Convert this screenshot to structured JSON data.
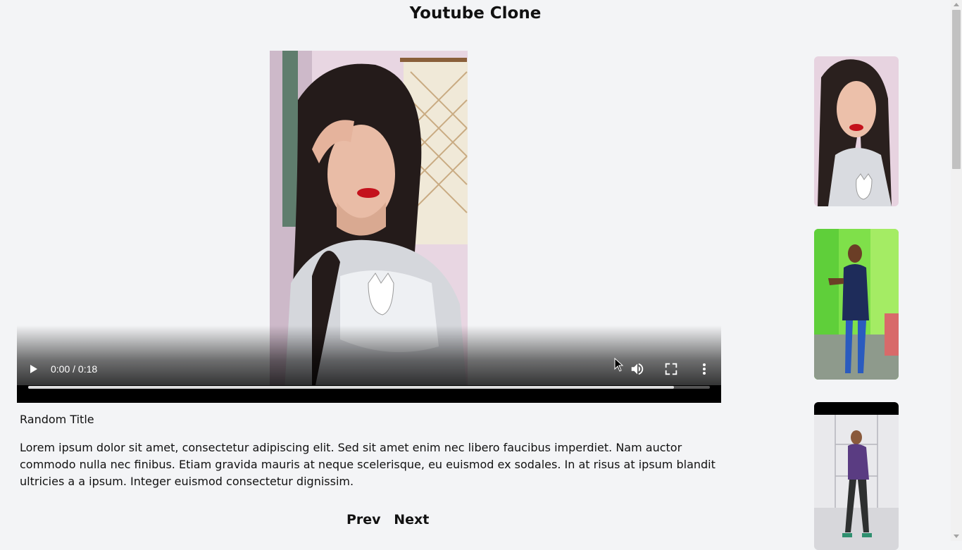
{
  "header": {
    "title": "Youtube Clone"
  },
  "player": {
    "time_display": "0:00 / 0:18",
    "progress_fraction": 0.0,
    "buffered_fraction": 0.947,
    "play_icon": "play-icon",
    "volume_icon": "volume-icon",
    "fullscreen_icon": "fullscreen-icon",
    "menu_icon": "more-vert-icon"
  },
  "video": {
    "title": "Random Title",
    "description": "Lorem ipsum dolor sit amet, consectetur adipiscing elit. Sed sit amet enim nec libero faucibus imperdiet. Nam auctor commodo nulla nec finibus. Etiam gravida mauris at neque scelerisque, eu euismod ex sodales. In at risus at ipsum blandit ultricies a a ipsum. Integer euismod consectetur dignissim."
  },
  "pagination": {
    "prev_label": "Prev",
    "next_label": "Next"
  },
  "colors": {
    "background": "#f3f4f6",
    "text": "#111111",
    "player_bar": "#000000"
  }
}
